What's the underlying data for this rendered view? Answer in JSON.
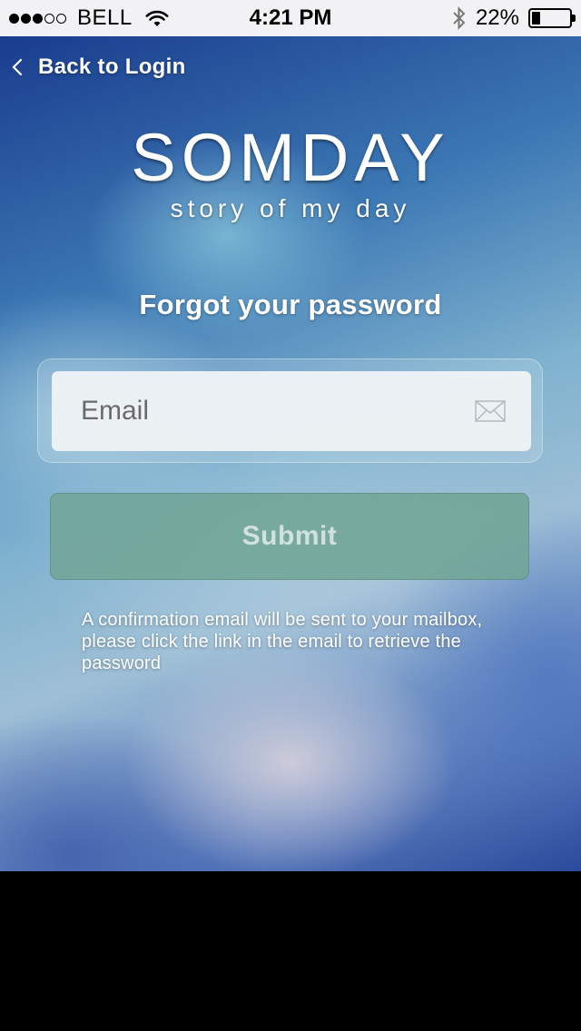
{
  "status_bar": {
    "carrier": "BELL",
    "time": "4:21 PM",
    "battery_percent": "22%",
    "battery_level": 0.22,
    "signal_bars_filled": 3,
    "signal_bars_total": 5
  },
  "nav": {
    "back_label": "Back to Login"
  },
  "logo": {
    "title": "SOMDAY",
    "tagline": "story of my day"
  },
  "form": {
    "heading": "Forgot your password",
    "email_placeholder": "Email",
    "email_value": "",
    "submit_label": "Submit",
    "note": "A confirmation email will be sent to your mailbox, please click the link in the email to retrieve the password"
  },
  "colors": {
    "submit_bg": "#72a596",
    "status_bar_bg": "#f2f2f4"
  },
  "icons": {
    "back": "chevron-left-icon",
    "email": "envelope-icon",
    "wifi": "wifi-icon",
    "bluetooth": "bluetooth-icon",
    "battery": "battery-icon"
  }
}
